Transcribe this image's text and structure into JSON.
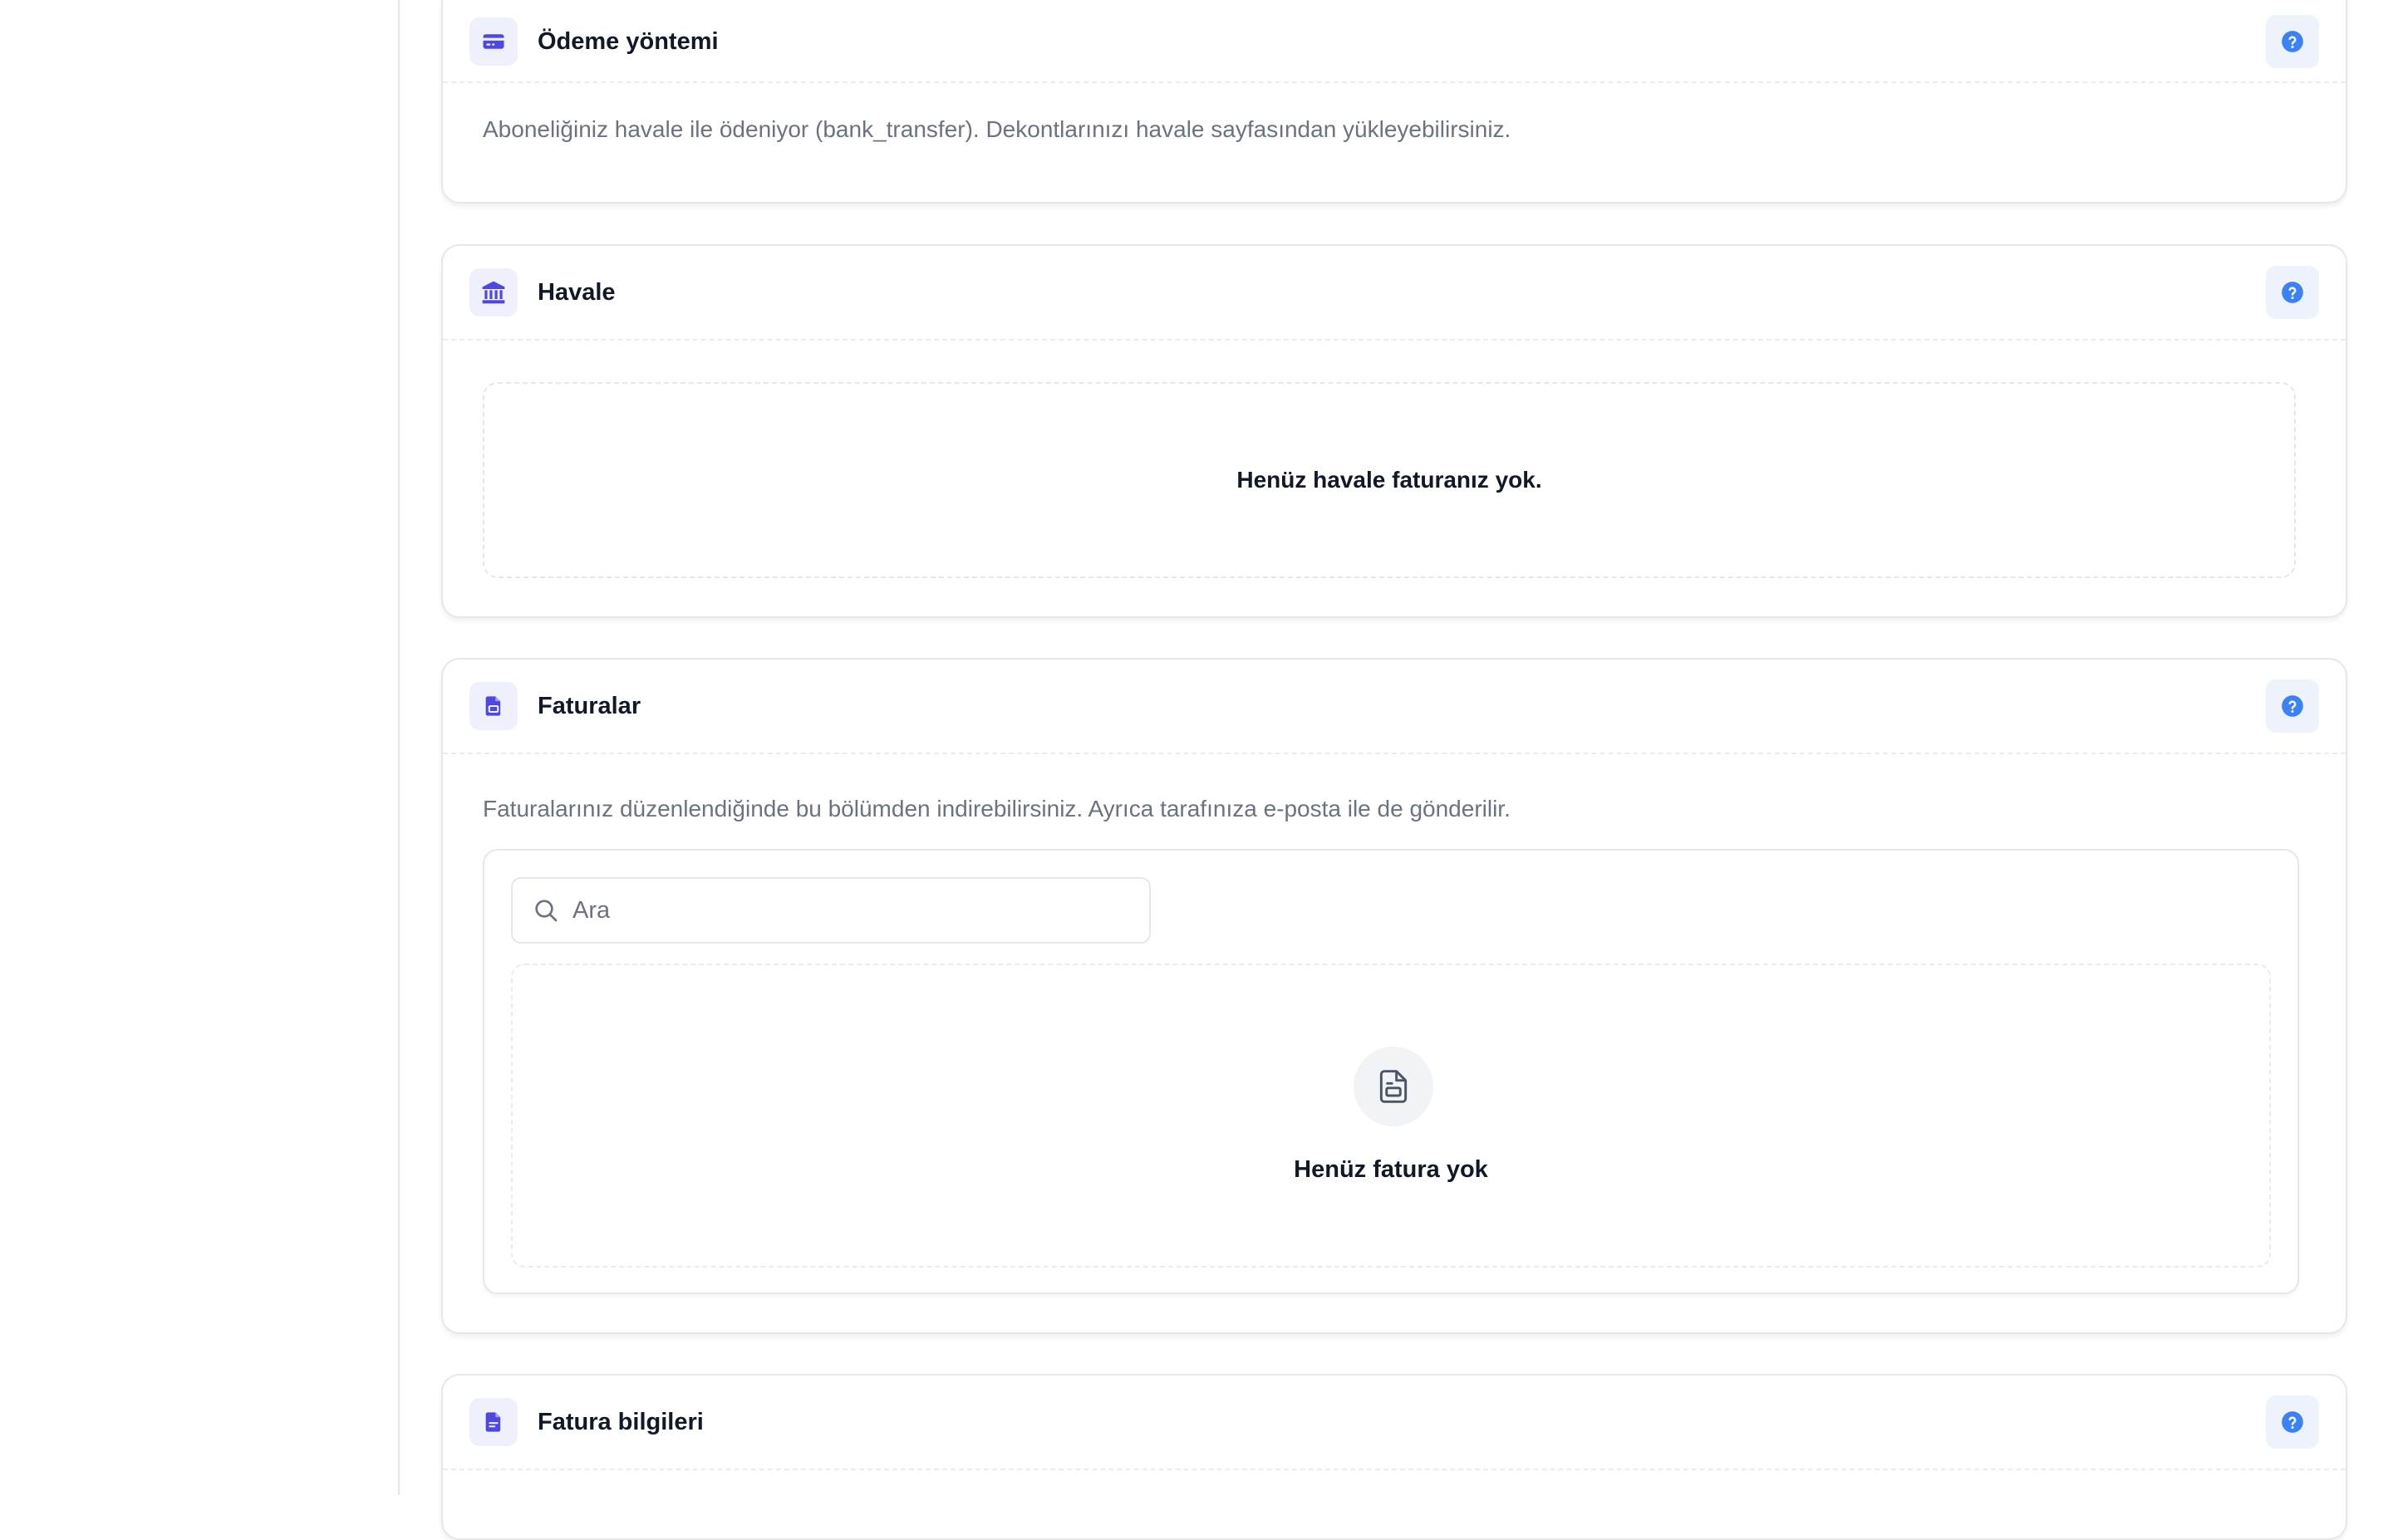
{
  "colors": {
    "accent": "#4f46e5",
    "help": "#3b82f6",
    "muted_text": "#6b7280",
    "border": "#e5e7eb"
  },
  "sections": {
    "payment_method": {
      "icon": "credit-card-icon",
      "title": "Ödeme yöntemi",
      "description": "Aboneliğiniz havale ile ödeniyor (bank_transfer). Dekontlarınızı havale sayfasından yükleyebilirsiniz."
    },
    "wire_transfer": {
      "icon": "bank-icon",
      "title": "Havale",
      "empty_text": "Henüz havale faturanız yok."
    },
    "invoices": {
      "icon": "file-icon",
      "title": "Faturalar",
      "description": "Faturalarınız düzenlendiğinde bu bölümden indirebilirsiniz. Ayrıca tarafınıza e-posta ile de gönderilir.",
      "search_placeholder": "Ara",
      "search_value": "",
      "empty_text": "Henüz fatura yok"
    },
    "billing_info": {
      "icon": "document-icon",
      "title": "Fatura bilgileri"
    }
  }
}
